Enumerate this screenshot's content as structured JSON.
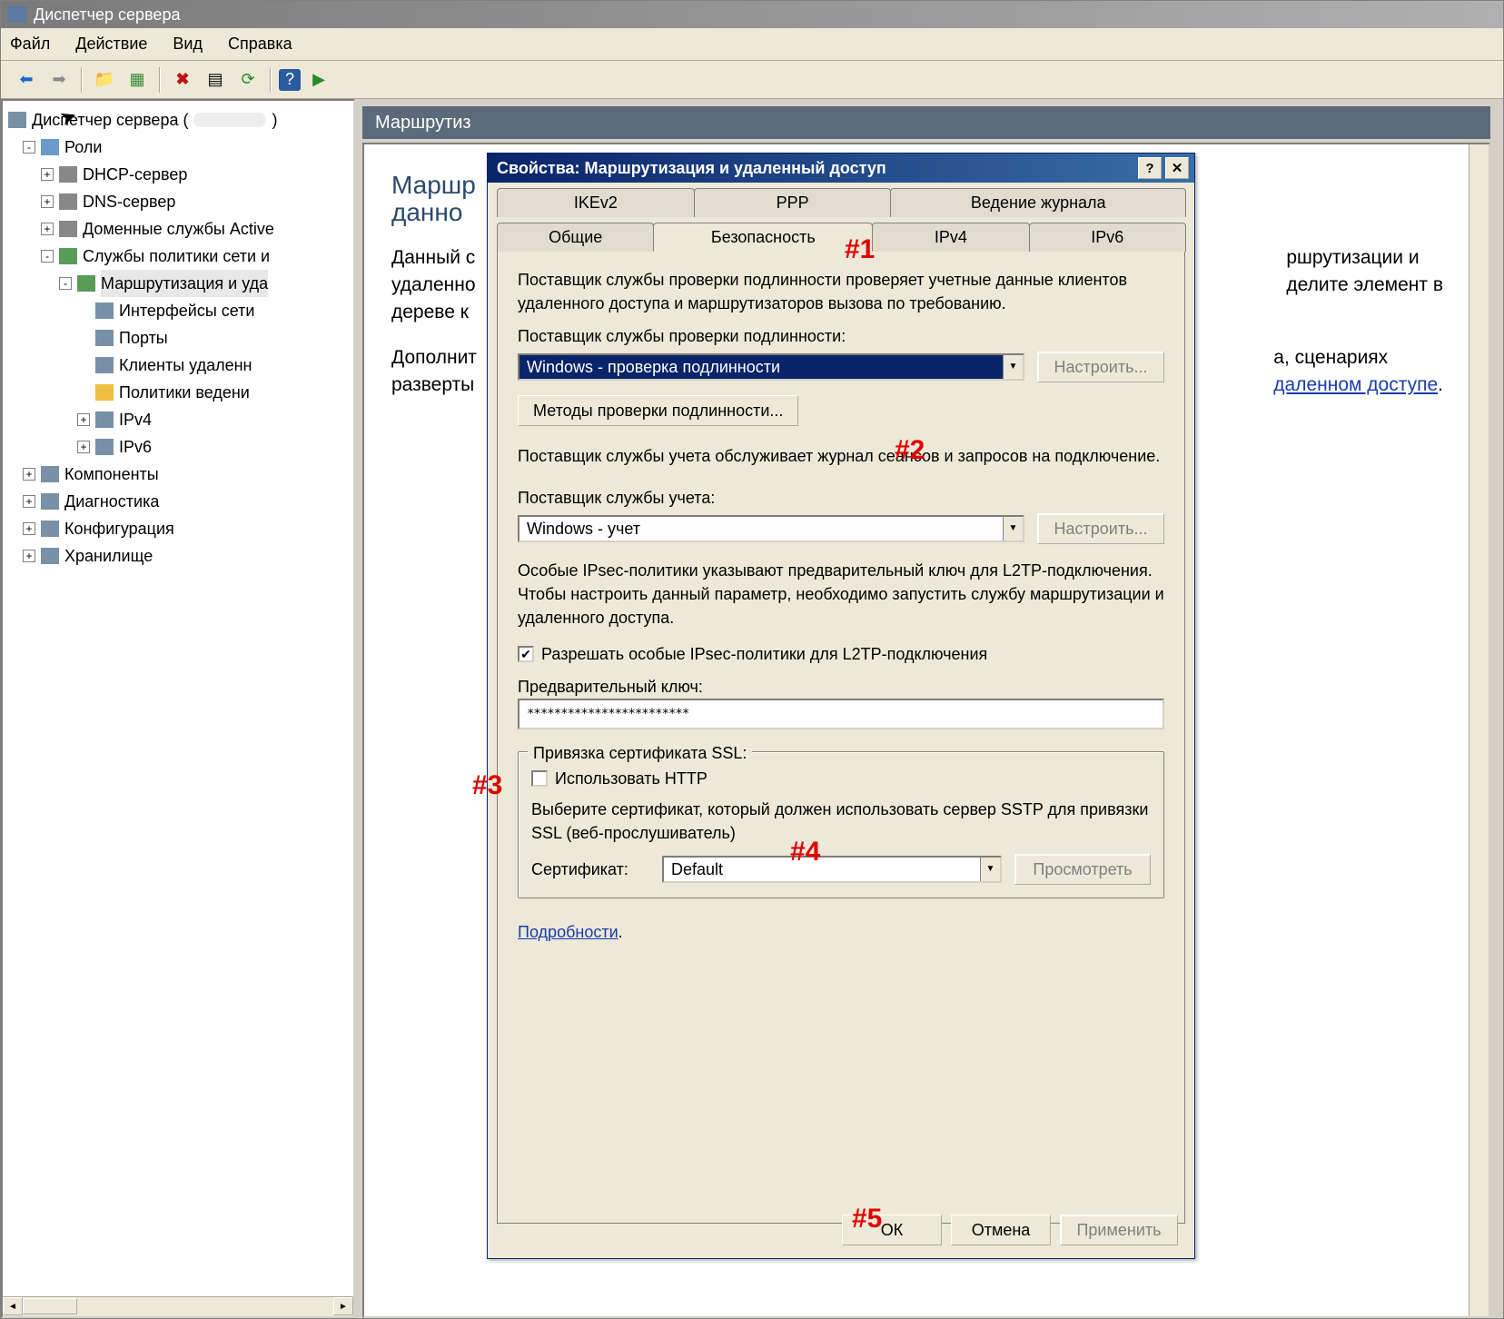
{
  "window": {
    "title": "Диспетчер сервера"
  },
  "menubar": [
    "Файл",
    "Действие",
    "Вид",
    "Справка"
  ],
  "tree": {
    "root": "Диспетчер сервера (",
    "items": [
      {
        "label": "Роли",
        "level": 1,
        "exp": "-",
        "icon": "role"
      },
      {
        "label": "DHCP-сервер",
        "level": 2,
        "exp": "+",
        "icon": "server"
      },
      {
        "label": "DNS-сервер",
        "level": 2,
        "exp": "+",
        "icon": "server"
      },
      {
        "label": "Доменные службы Active",
        "level": 2,
        "exp": "+",
        "icon": "server"
      },
      {
        "label": "Службы политики сети и",
        "level": 2,
        "exp": "-",
        "icon": "net"
      },
      {
        "label": "Маршрутизация и уда",
        "level": 3,
        "exp": "-",
        "icon": "net",
        "selected": true
      },
      {
        "label": "Интерфейсы сети",
        "level": 4,
        "exp": "",
        "icon": "comp"
      },
      {
        "label": "Порты",
        "level": 4,
        "exp": "",
        "icon": "comp"
      },
      {
        "label": "Клиенты удаленн",
        "level": 4,
        "exp": "",
        "icon": "comp"
      },
      {
        "label": "Политики ведени",
        "level": 4,
        "exp": "",
        "icon": "folder"
      },
      {
        "label": "IPv4",
        "level": 4,
        "exp": "+",
        "icon": "comp"
      },
      {
        "label": "IPv6",
        "level": 4,
        "exp": "+",
        "icon": "comp"
      },
      {
        "label": "Компоненты",
        "level": 1,
        "exp": "+",
        "icon": "comp"
      },
      {
        "label": "Диагностика",
        "level": 1,
        "exp": "+",
        "icon": "comp"
      },
      {
        "label": "Конфигурация",
        "level": 1,
        "exp": "+",
        "icon": "comp"
      },
      {
        "label": "Хранилище",
        "level": 1,
        "exp": "+",
        "icon": "comp"
      }
    ]
  },
  "main": {
    "header": "Маршрутиз",
    "h1_part1": "Маршр",
    "h1_part2": "данно",
    "p1_a": "Данный с",
    "p1_b": "удаленно",
    "p1_c": "дереве к",
    "p1_right1": "ршрутизации и",
    "p1_right2": "делите элемент в",
    "p2_a": "Дополнит",
    "p2_b": "разверты",
    "p2_right1": "а, сценариях",
    "p2_link": "даленном доступе"
  },
  "dialog": {
    "title": "Свойства: Маршрутизация и удаленный доступ",
    "tabs_row1": [
      "IKEv2",
      "PPP",
      "Ведение журнала"
    ],
    "tabs_row2": [
      "Общие",
      "Безопасность",
      "IPv4",
      "IPv6"
    ],
    "active_tab": "Безопасность",
    "auth_desc": "Поставщик службы проверки подлинности проверяет учетные данные клиентов удаленного доступа и маршрутизаторов вызова по требованию.",
    "auth_label": "Поставщик службы проверки подлинности:",
    "auth_value": "Windows - проверка подлинности",
    "configure_btn": "Настроить...",
    "methods_btn": "Методы проверки подлинности...",
    "acct_desc": "Поставщик службы учета обслуживает журнал сеансов и запросов на подключение.",
    "acct_label": "Поставщик службы учета:",
    "acct_value": "Windows - учет",
    "ipsec_desc": "Особые IPsec-политики указывают предварительный ключ для L2TP-подключения. Чтобы настроить данный параметр, необходимо запустить службу маршрутизации и удаленного доступа.",
    "ipsec_chk": "Разрешать особые IPsec-политики для L2TP-подключения",
    "psk_label": "Предварительный ключ:",
    "psk_value": "************************",
    "ssl_legend": "Привязка сертификата SSL:",
    "http_chk": "Использовать HTTP",
    "ssl_desc": "Выберите сертификат, который должен использовать сервер SSTP для привязки SSL (веб-прослушиватель)",
    "cert_label": "Сертификат:",
    "cert_value": "Default",
    "view_btn": "Просмотреть",
    "details_link": "Подробности",
    "ok": "ОК",
    "cancel": "Отмена",
    "apply": "Применить"
  },
  "annotations": [
    "#1",
    "#2",
    "#3",
    "#4",
    "#5"
  ]
}
